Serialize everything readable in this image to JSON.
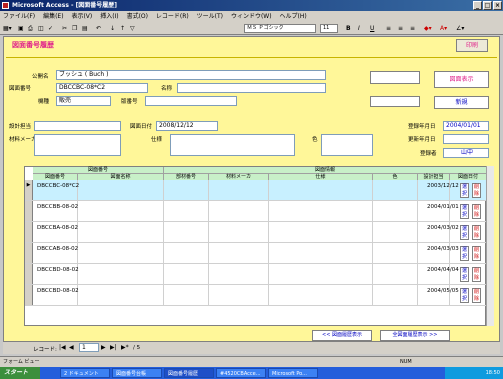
{
  "window": {
    "title": "Microsoft Access - [図面番号履歴]"
  },
  "menu": [
    "ファイル(F)",
    "編集(E)",
    "表示(V)",
    "挿入(I)",
    "書式(O)",
    "レコード(R)",
    "ツール(T)",
    "ウィンドウ(W)",
    "ヘルプ(H)"
  ],
  "toolbar": {
    "font": "ＭＳ Ｐゴシック",
    "size": "11"
  },
  "form": {
    "title": "図面番号履歴",
    "print_label": "印刷",
    "public_name_label": "公開名",
    "public_name": "ブッシュ ( Buch )",
    "drawing_no_label": "図面番号",
    "drawing_no": "DBCCBC-08*C2",
    "part_label": "名称",
    "model_label": "機種",
    "model": "販売",
    "version_label": "版番号",
    "design_label": "設計担当",
    "date_label": "図面日付",
    "date": "2008/12/12",
    "material_label": "材料メーカ",
    "spec_label": "仕様",
    "color_label": "色",
    "reg_date_label": "登録年月日",
    "reg_date": "2004/01/01",
    "update_label": "更新年月日",
    "owner_label": "登録者",
    "owner": "山中",
    "new_button": "新規",
    "btn_top": "図面表示",
    "btn_mid": ""
  },
  "grid": {
    "group1": "図面番号",
    "group2": "図面情報",
    "headers": [
      "図面番号",
      "図面名称",
      "部材番号",
      "材料メーカ",
      "仕様",
      "色",
      "設計担当",
      "図面日付"
    ],
    "rows": [
      {
        "no": "DBCCBC-08*C2",
        "date": "2003/12/12"
      },
      {
        "no": "DBCCBB-08-02",
        "date": "2004/01/01"
      },
      {
        "no": "DBCCBA-08-02",
        "date": "2004/03/02"
      },
      {
        "no": "DBCCAB-08-02",
        "date": "2004/03/03"
      },
      {
        "no": "DBCCBD-08-02",
        "date": "2004/04/04"
      },
      {
        "no": "DBCCBD-08-02",
        "date": "2004/05/05"
      }
    ],
    "row_btn_a": "選択",
    "row_btn_b": "削除"
  },
  "buttons": {
    "prev_history": "<< 図面履歴表示",
    "next_history": "全図面履歴表示 >>"
  },
  "nav": {
    "label": "レコード:",
    "current": "1",
    "of": "/ 5"
  },
  "status": {
    "left": "フォーム ビュー",
    "right": "NUM"
  },
  "taskbar": {
    "start": "スタート",
    "tasks": [
      "2 ドキュメント",
      "図面番号台帳",
      "図面番号履歴",
      "#4520CBAcce...",
      "Microsoft Po..."
    ],
    "clock": "18:50"
  }
}
